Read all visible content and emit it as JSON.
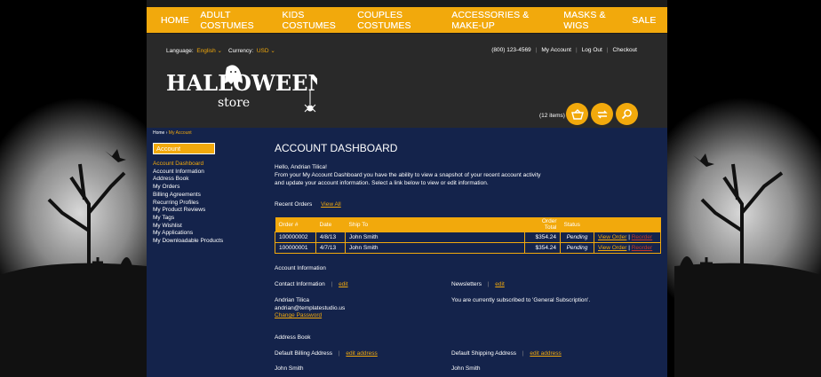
{
  "nav": [
    "HOME",
    "ADULT COSTUMES",
    "KIDS COSTUMES",
    "COUPLES COSTUMES",
    "ACCESSORIES & MAKE-UP",
    "MASKS & WIGS",
    "SALE"
  ],
  "header": {
    "language_label": "Language:",
    "language_value": "English",
    "currency_label": "Currency:",
    "currency_value": "USD",
    "phone": "(800) 123-4569",
    "my_account": "My Account",
    "log_out": "Log Out",
    "checkout": "Checkout",
    "logo_main": "HALLOWEEN",
    "logo_sub": "store",
    "cart_items": "(12 items)"
  },
  "breadcrumb": {
    "home": "Home",
    "sep": "›",
    "current": "My Account"
  },
  "sidebar": {
    "title": "Account",
    "items": [
      "Account Dashboard",
      "Account Information",
      "Address Book",
      "My Orders",
      "Billing Agreements",
      "Recurring Profiles",
      "My Product Reviews",
      "My Tags",
      "My Wishlist",
      "My Applications",
      "My Downloadable Products"
    ]
  },
  "dashboard": {
    "title": "ACCOUNT DASHBOARD",
    "hello": "Hello, Andrian Tilica!",
    "intro": "From your My Account Dashboard you have the ability to view a snapshot of your recent account activity and update your account information. Select a link below to view or edit information.",
    "recent_orders": "Recent Orders",
    "view_all": "View All",
    "columns": [
      "Order #",
      "Date",
      "Ship To",
      "Order Total",
      "Status"
    ],
    "orders": [
      {
        "order": "100000002",
        "date": "4/8/13",
        "ship_to": "John Smith",
        "total": "$354.24",
        "status": "Pending",
        "view": "View Order",
        "reorder": "Reorder"
      },
      {
        "order": "100000001",
        "date": "4/7/13",
        "ship_to": "John Smith",
        "total": "$354.24",
        "status": "Pending",
        "view": "View Order",
        "reorder": "Reorder"
      }
    ],
    "account_info": "Account Information",
    "contact_info": "Contact Information",
    "edit": "edit",
    "name": "Andrian Tilica",
    "email": "andrian@templatestudio.us",
    "change_password": "Change Password",
    "newsletters": "Newsletters",
    "newsletter_text": "You are currently subscribed to 'General Subscription'.",
    "address_book": "Address Book",
    "billing_address": "Default Billing Address",
    "shipping_address": "Default Shipping Address",
    "edit_address": "edit address",
    "billing_name": "John Smith",
    "shipping_name": "John Smith"
  },
  "colors": {
    "accent": "#f2a90c",
    "nav_bg": "#f2a90c",
    "header_bg": "#292929",
    "main_bg": "#14234b",
    "reorder": "#c0392b"
  },
  "icons": [
    "basket-icon",
    "compare-arrows-icon",
    "search-icon",
    "ghost-icon",
    "spider-icon",
    "chevron-down-icon"
  ]
}
